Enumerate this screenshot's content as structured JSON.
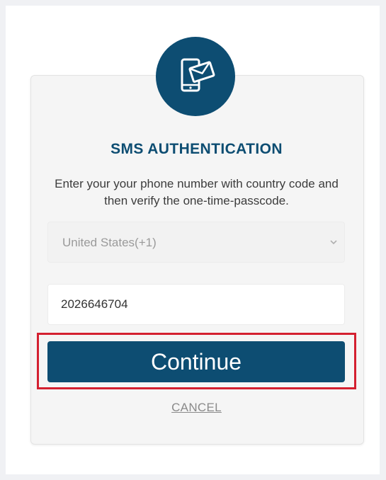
{
  "header": {
    "icon": "phone-message-icon",
    "title": "SMS AUTHENTICATION",
    "description": "Enter your your phone number with country code and then verify the one-time-passcode."
  },
  "form": {
    "country_select": {
      "value": "United States(+1)",
      "icon": "chevron-down-icon"
    },
    "phone_input": {
      "value": "2026646704"
    },
    "continue_label": "Continue",
    "cancel_label": "CANCEL"
  },
  "colors": {
    "brand": "#0d4d72",
    "highlight": "#d42030",
    "card_background": "#f5f5f5"
  }
}
